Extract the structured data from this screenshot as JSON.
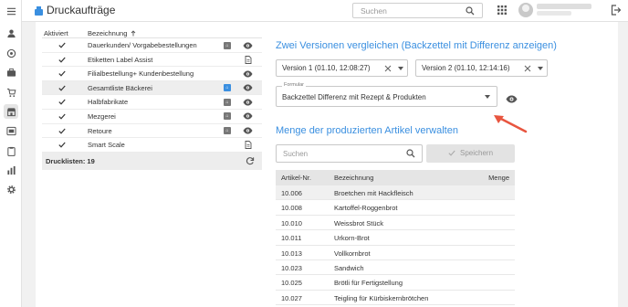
{
  "header": {
    "title": "Druckaufträge",
    "search_placeholder": "Suchen"
  },
  "nav_icons": [
    "menu-icon",
    "user-icon",
    "target-icon",
    "briefcase-icon",
    "cart-icon",
    "store-icon",
    "dashboard-icon",
    "clipboard-icon",
    "clock-icon",
    "chart-icon",
    "gear-icon"
  ],
  "print_list": {
    "col_active": "Aktiviert",
    "col_name": "Bezeichnung",
    "items": [
      {
        "name": "Dauerkunden/ Vorgabebestellungen"
      },
      {
        "name": "Etiketten Label Assist"
      },
      {
        "name": "Filialbestellung+ Kundenbestellung"
      },
      {
        "name": "Gesamtliste Bäckerei"
      },
      {
        "name": "Halbfabrikate"
      },
      {
        "name": "Mezgerei"
      },
      {
        "name": "Retoure"
      },
      {
        "name": "Smart Scale"
      }
    ],
    "footer": "Drucklisten: 19"
  },
  "compare": {
    "title": "Zwei Versionen vergleichen (Backzettel mit Differenz anzeigen)",
    "version1": "Version 1 (01.10, 12:08:27)",
    "version2": "Version 2 (01.10, 12:14:16)",
    "formular_label": "Formular",
    "formular_value": "Backzettel Differenz mit Rezept & Produkten"
  },
  "quantity": {
    "title": "Menge der produzierten Artikel verwalten",
    "search_placeholder": "Suchen",
    "save_label": "Speichern",
    "col_nr": "Artikel-Nr.",
    "col_name": "Bezeichnung",
    "col_qty": "Menge",
    "rows": [
      {
        "nr": "10.006",
        "name": "Broetchen mit Hackfleisch"
      },
      {
        "nr": "10.008",
        "name": "Kartoffel-Roggenbrot"
      },
      {
        "nr": "10.010",
        "name": "Weissbrot Stück"
      },
      {
        "nr": "10.011",
        "name": "Urkorn-Brot"
      },
      {
        "nr": "10.013",
        "name": "Vollkornbrot"
      },
      {
        "nr": "10.023",
        "name": "Sandwich"
      },
      {
        "nr": "10.025",
        "name": "Brötli für Fertigstellung"
      },
      {
        "nr": "10.027",
        "name": "Teigling für Kürbiskernbrötchen"
      }
    ]
  },
  "colors": {
    "accent": "#3a8fe0",
    "arrow": "#e8553f"
  }
}
